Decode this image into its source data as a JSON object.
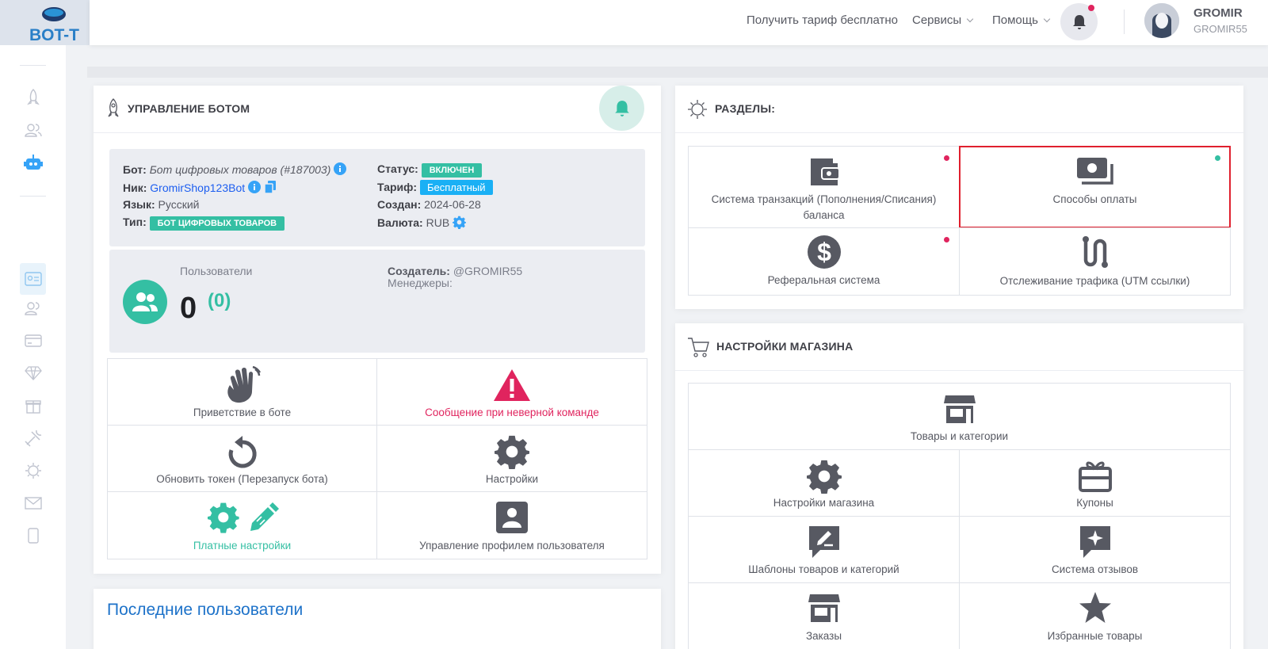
{
  "logo": {
    "text": "BOT-T"
  },
  "header": {
    "links": [
      "Получить тариф бесплатно",
      "Сервисы",
      "Помощь"
    ],
    "user_name": "GROMIR",
    "user_login": "GROMIR55"
  },
  "bot_panel": {
    "title": "УПРАВЛЕНИЕ БОТОМ",
    "bot_label": "Бот:",
    "bot_value": "Бот цифровых товаров (#187003)",
    "nick_label": "Ник:",
    "nick_value": "GromirShop123Bot",
    "lang_label": "Язык:",
    "lang_value": "Русский",
    "type_label": "Тип:",
    "type_value": "БОТ ЦИФРОВЫХ ТОВАРОВ",
    "status_label": "Статус:",
    "status_value": "ВКЛЮЧЕН",
    "tariff_label": "Тариф:",
    "tariff_value": "Бесплатный",
    "created_label": "Создан:",
    "created_value": "2024-06-28",
    "currency_label": "Валюта:",
    "currency_value": "RUB",
    "users_label": "Пользователи",
    "users_count": "0",
    "users_new": "(0)",
    "creator_label": "Создатель:",
    "creator_value": "@GROMIR55",
    "managers_label": "Менеджеры:",
    "actions": [
      {
        "label": "Приветствие в боте",
        "icon": "hand-wave-icon"
      },
      {
        "label": "Сообщение при неверной команде",
        "icon": "warning-icon"
      },
      {
        "label": "Обновить токен (Перезапуск бота)",
        "icon": "refresh-icon"
      },
      {
        "label": "Настройки",
        "icon": "gear-icon"
      },
      {
        "label": "Платные настройки",
        "icon": "paid-settings-icon"
      },
      {
        "label": "Управление профилем пользователя",
        "icon": "user-profile-icon"
      }
    ]
  },
  "recent_users": {
    "title": "Последние пользователи"
  },
  "sections_panel": {
    "title": "РАЗДЕЛЫ:",
    "items": [
      {
        "label": "Система транзакций (Пополнения/Списания) баланса",
        "icon": "wallet-icon"
      },
      {
        "label": "Способы оплаты",
        "icon": "money-icon"
      },
      {
        "label": "Реферальная система",
        "icon": "dollar-coin-icon"
      },
      {
        "label": "Отслеживание трафика (UTM ссылки)",
        "icon": "route-icon"
      }
    ]
  },
  "shop_panel": {
    "title": "НАСТРОЙКИ МАГАЗИНА",
    "items": [
      {
        "label": "Товары и категории",
        "icon": "store-icon"
      },
      {
        "label": "Настройки магазина",
        "icon": "gear-icon"
      },
      {
        "label": "Купоны",
        "icon": "gift-icon"
      },
      {
        "label": "Шаблоны товаров и категорий",
        "icon": "edit-message-icon"
      },
      {
        "label": "Система отзывов",
        "icon": "review-star-icon"
      },
      {
        "label": "Заказы",
        "icon": "store-icon"
      },
      {
        "label": "Избранные товары",
        "icon": "star-icon"
      }
    ]
  },
  "colors": {
    "accent": "#34bfa3",
    "danger": "#e0245e",
    "info": "#36a3f7",
    "link": "#1d5ef0"
  }
}
